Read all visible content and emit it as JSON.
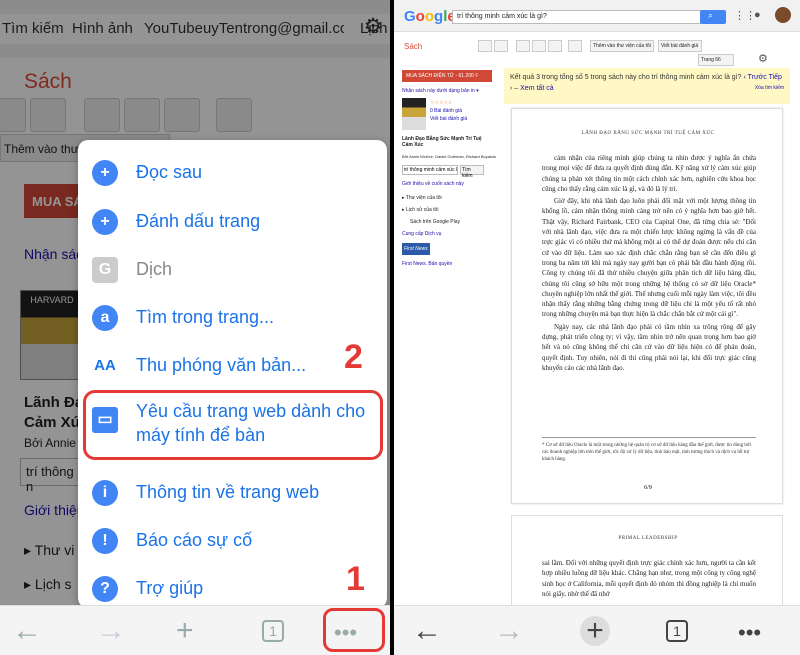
{
  "left": {
    "topbar": {
      "search_tab": "Tìm kiếm",
      "images_tab": "Hình ảnh",
      "other_tabs": "YouTubeuyTentrong@gmail.com Drive",
      "trailing": "Lịch"
    },
    "section_title": "Sách",
    "toolbar_label": "Thêm vào thư",
    "buy_button": "MUA SÁ",
    "get_book": "Nhận sác",
    "book_cover_text": "HARVARD",
    "book_title_1": "Lãnh Đạo",
    "book_title_2": "Cảm Xúc",
    "author": "Bởi Annie M",
    "search_in_book": "trí thông n",
    "intro_link": "Giới thiệu",
    "library": "Thư vi",
    "history": "Lịch s",
    "menu": [
      {
        "icon": "clock-plus-icon",
        "glyph": "+",
        "label": "Đọc sau"
      },
      {
        "icon": "bookmark-star-icon",
        "glyph": "+",
        "label": "Đánh dấu trang"
      },
      {
        "icon": "translate-icon",
        "glyph": "G",
        "label": "Dịch"
      },
      {
        "icon": "find-in-page-icon",
        "glyph": "a",
        "label": "Tìm trong trang..."
      },
      {
        "icon": "text-zoom-icon",
        "glyph": "AA",
        "label": "Thu phóng văn bản..."
      },
      {
        "icon": "desktop-icon",
        "glyph": "▭",
        "label": "Yêu cầu trang web dành cho máy tính để bàn"
      },
      {
        "icon": "info-icon",
        "glyph": "i",
        "label": "Thông tin về trang web"
      },
      {
        "icon": "report-icon",
        "glyph": "!",
        "label": "Báo cáo sự cố"
      },
      {
        "icon": "help-icon",
        "glyph": "?",
        "label": "Trợ giúp"
      }
    ],
    "step1": "1",
    "step2": "2",
    "tab_count": "1"
  },
  "right": {
    "logo": "Google",
    "search_query": "trí thông minh cảm xúc là gì?",
    "section_title": "Sách",
    "tb_add": "Thêm vào thư viện của tôi",
    "tb_review": "Viết bài đánh giá",
    "page_label": "Trang 66",
    "buy": "MUA SÁCH ĐIỆN TỬ - 61.200 ₫",
    "get_print": "Nhận sách này dưới dạng bản in ▾",
    "reviews": "0 Bài đánh giá",
    "write_review": "Viết bài đánh giá",
    "book_title": "Lãnh Đạo Bằng Sức Mạnh Trí Tuệ Cảm Xúc",
    "authors": "Bởi Annie McKee, Daniel Goleman, Richard Boyatzis",
    "search_in": "trí thông minh cảm xúc là gì",
    "search_btn": "Tìm kiếm",
    "intro": "Giới thiệu về cuốn sách này",
    "lib": "▸ Thư viện của tôi",
    "history": "▸ Lịch sử của tôi",
    "play": "Sách trên Google Play",
    "terms": "Cung cấp Dịch vụ",
    "publisher": "First News",
    "publisher_link": "First News. Bản quyền",
    "result_text": "Kết quả 3 trong tổng số 5 trong sách này cho trí thông minh cảm xúc là gì?",
    "prev": "‹ Trước",
    "next": "Tiếp ›",
    "see_all": "Xem tất cả",
    "clear": "Xóa tìm kiếm",
    "page_title": "LÃNH ĐẠO BẰNG SỨC MẠNH TRÍ TUỆ CẢM XÚC",
    "p1": "cảm nhận của riêng mình giúp chúng ta nhìn được ý nghĩa ẩn chứa trong mọi việc để đưa ra quyết định đúng đắn. Kỹ năng xử lý cảm xúc giúp chúng ta phán xét thông tin một cách chính xác hơn, nghiên cứu khoa học cũng cho thấy rằng cảm xúc là gì, và đó là lý trí.",
    "p2": "Giờ đây, khi nhà lãnh đạo luôn phải đối mặt với một lượng thông tin khổng lồ, cảm nhận thông minh càng trở nên có ý nghĩa hơn bao giờ hết. Thật vậy, Richard Fairbank, CEO của Capital One, đã từng chia sẻ: \"Đối với nhà lãnh đạo, việc đưa ra một chiến lược không ngừng là vấn đề của trực giác vì có nhiều thứ mà không một ai có thể dự đoán được nếu chỉ căn cứ vào dữ liệu. Làm sao xác định chắc chắn rằng bạn sẽ cần đến điều gì trong ba năm tới khi mà ngày nay gười bạn có phải bắt đầu hành động rồi. Công ty chúng tôi đã thử nhiều chuyện giữa phân tích dữ liệu hàng đầu, chúng tôi cũng sở hữu một trong những hệ thống có sở dữ liệu Oracle* chuyên nghiệp lớn nhất thế giới. Thế nhưng cuối mỗi ngày làm việc, tôi đều nhận thấy rằng những bằng chứng trong dữ liệu chỉ là một yếu tố rất nhỏ trong những chuyện mà bạn thực hiện là chắc chắn bắt cứ một cái gì\".",
    "p3": "Ngày nay, các nhà lãnh đạo phải có tầm nhìn xa trông rộng để gây dựng, phát triển công ty; vì vậy, tầm nhìn trở nên quan trọng hơn bao giờ hết và nó cũng không thể chỉ căn cứ vào dữ liệu hiện có để phán đoán, quyết định. Tuy nhiên, nói đi thì cũng phải nói lại, khi đối trực giác cũng khuyến cáo các nhà lãnh đạo.",
    "footnote": "* Cơ sở dữ liệu Oracle là một trong những hệ quản trị cơ sở dữ liệu hàng đầu thế giới, được tin dùng bởi các doanh nghiệp lớn trên thế giới, tốc độ xử lý dữ liệu, tính bảo mật, tính tương thích và dịch vụ hỗ trợ khách hàng.",
    "page_num": "6/9",
    "page2_header": "PRIMAL LEADERSHIP",
    "page2_text": "sai lầm. Đối với những quyết định trực giác chính xác hơn, người ta cần kết hợp nhiều luồng dữ liệu khác. Chẳng hạn như, trong một công ty công nghệ sinh học ở California, mỗi quyết định đó nhóm thì đồng nghiệp là chỉ muốn nói giấy, nhờ thế đã nhớ"
  }
}
